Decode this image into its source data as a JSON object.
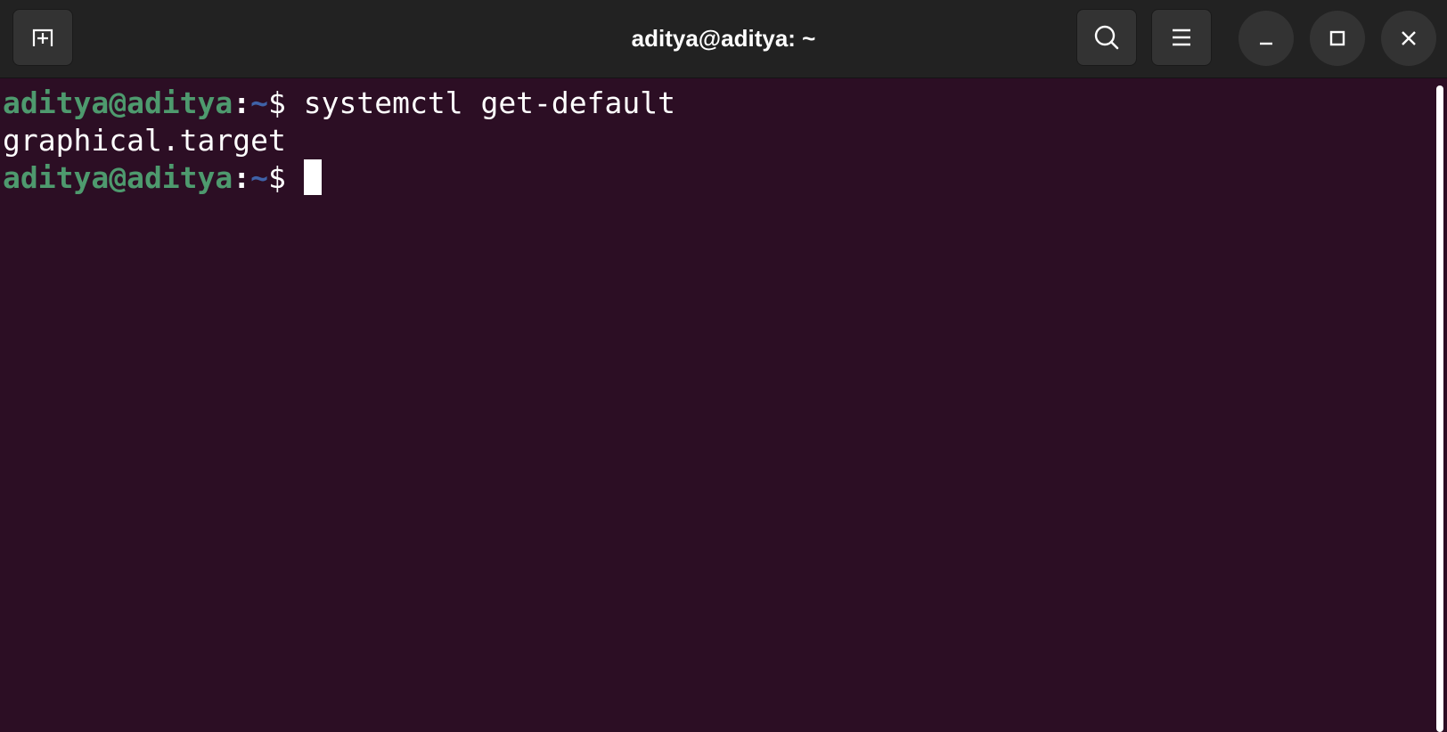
{
  "window": {
    "title": "aditya@aditya: ~"
  },
  "toolbar": {
    "new_tab_icon": "new-tab-icon",
    "search_icon": "search-icon",
    "menu_icon": "hamburger-menu-icon",
    "minimize_icon": "minimize-icon",
    "maximize_icon": "maximize-icon",
    "close_icon": "close-icon"
  },
  "terminal": {
    "lines": [
      {
        "user_host": "aditya@aditya",
        "colon": ":",
        "path": "~",
        "symbol": "$",
        "command": " systemctl get-default"
      },
      {
        "output": "graphical.target"
      },
      {
        "user_host": "aditya@aditya",
        "colon": ":",
        "path": "~",
        "symbol": "$",
        "command": " "
      }
    ]
  },
  "colors": {
    "background": "#2c0e24",
    "titlebar": "#222222",
    "prompt_user": "#4e9a6e",
    "prompt_path": "#3f62a8",
    "text": "#ffffff"
  }
}
